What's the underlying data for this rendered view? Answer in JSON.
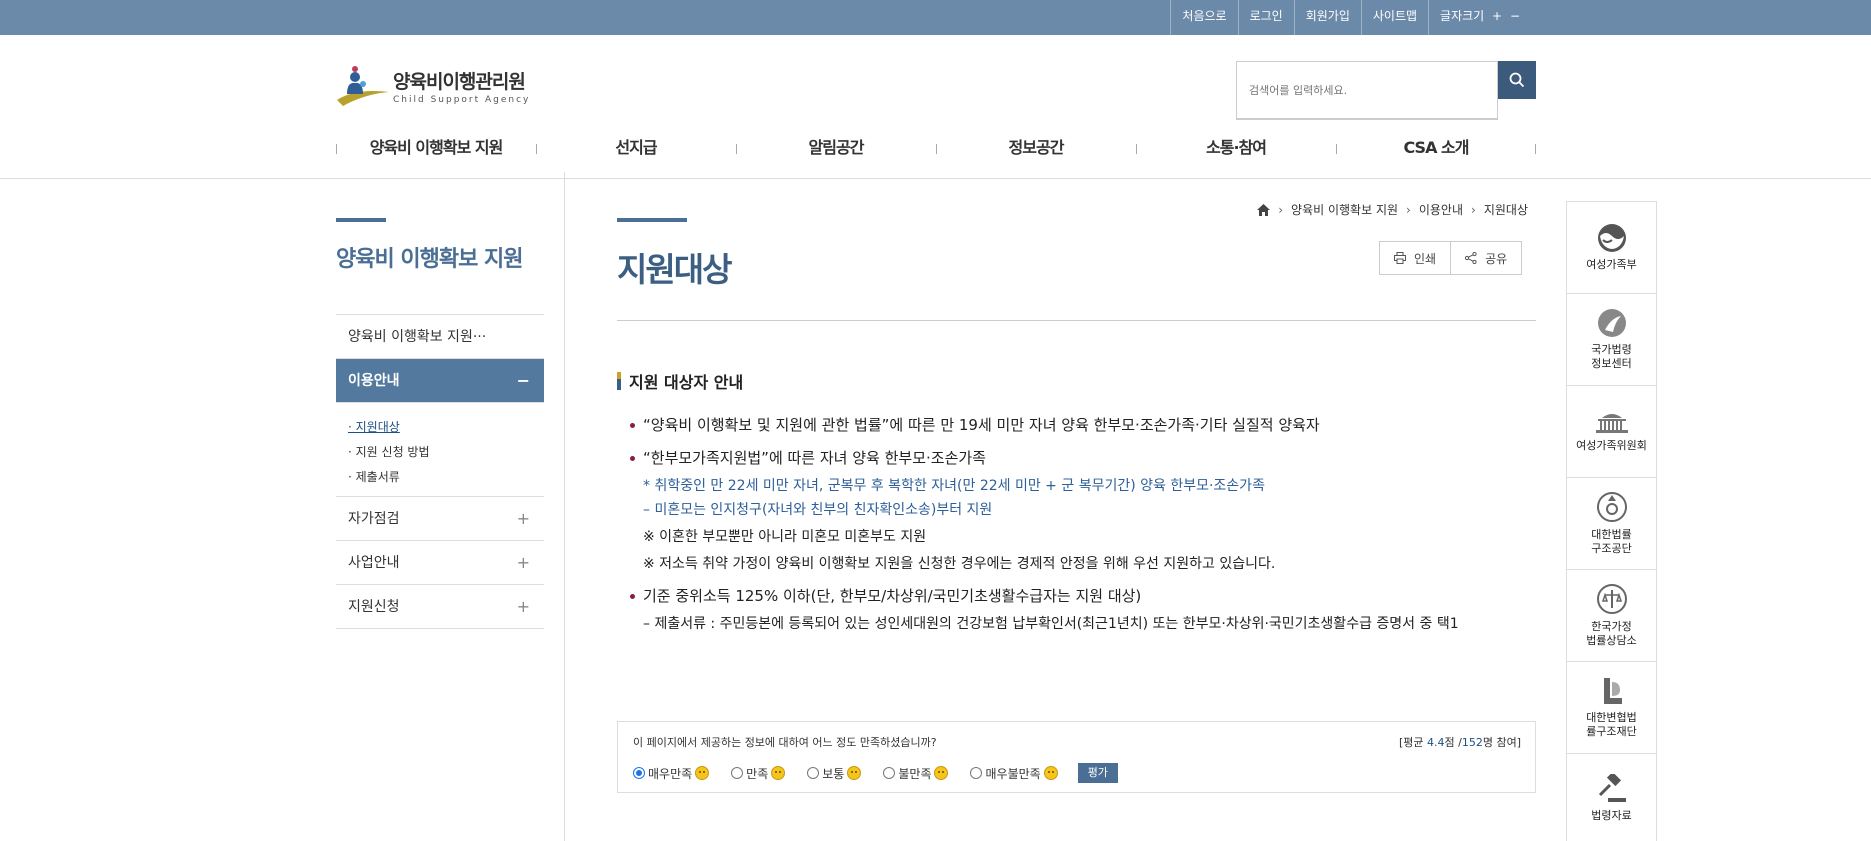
{
  "util_menu": [
    "처음으로",
    "로그인",
    "회원가입",
    "사이트맵"
  ],
  "font_size": {
    "label": "글자크기",
    "plus": "+",
    "minus": "−"
  },
  "logo": {
    "ko": "양육비이행관리원",
    "en": "Child Support Agency"
  },
  "search": {
    "placeholder": "검색어를 입력하세요.",
    "icon": "search-icon"
  },
  "gnb": [
    "양육비 이행확보 지원",
    "선지급",
    "알림공간",
    "정보공간",
    "소통·참여",
    "CSA 소개"
  ],
  "lnb": {
    "title": "양육비 이행확보 지원",
    "items": [
      {
        "label": "양육비 이행확보 지원···"
      },
      {
        "label": "이용안내",
        "toggle": "−"
      },
      {
        "label": "자가점검",
        "toggle": "+"
      },
      {
        "label": "사업안내",
        "toggle": "+"
      },
      {
        "label": "지원신청",
        "toggle": "+"
      }
    ],
    "sub": [
      "· 지원대상",
      "· 지원 신청 방법",
      "· 제출서류"
    ]
  },
  "breadcrumb": [
    "양육비 이행확보 지원",
    "이용안내",
    "지원대상"
  ],
  "page_title": "지원대상",
  "tools": {
    "print": "인쇄",
    "share": "공유"
  },
  "section_title": "지원 대상자 안내",
  "content": {
    "b1": "“양육비 이행확보 및 지원에 관한 법률”에 따른 만 19세 미만 자녀 양육 한부모·조손가족·기타 실질적 양육자",
    "b2": "“한부모가족지원법”에 따른 자녀 양육 한부모·조손가족",
    "n1": "* 취학중인 만 22세 미만 자녀, 군복무 후 복학한 자녀(만 22세 미만 + 군 복무기간) 양육 한부모·조손가족",
    "n2": "– 미혼모는 인지청구(자녀와 친부의 친자확인소송)부터 지원",
    "n3": "※ 이혼한 부모뿐만 아니라 미혼모 미혼부도 지원",
    "n4": "※ 저소득 취약 가정이 양육비 이행확보 지원을 신청한 경우에는 경제적 안정을 위해 우선 지원하고 있습니다.",
    "b3": "기준 중위소득 125% 이하(단, 한부모/차상위/국민기초생활수급자는 지원 대상)",
    "n5": "– 제출서류 : 주민등본에 등록되어 있는 성인세대원의 건강보험 납부확인서(최근1년치) 또는 한부모·차상위·국민기초생활수급 증명서 중 택1"
  },
  "survey": {
    "question": "이 페이지에서 제공하는 정보에 대하여 어느 정도 만족하셨습니까?",
    "avg_prefix": "[평균 ",
    "avg_score": "4.4",
    "avg_mid": "점 /",
    "avg_count": "152",
    "avg_suffix": "명 참여]",
    "options": [
      "매우만족",
      "만족",
      "보통",
      "불만족",
      "매우불만족"
    ],
    "selected": "매우만족",
    "submit": "평가"
  },
  "quick_links": [
    "여성가족부",
    "국가법령\n정보센터",
    "여성가족위원회",
    "대한법률\n구조공단",
    "한국가정\n법률상담소",
    "대한변협법\n률구조재단",
    "법령자료"
  ],
  "colors": {
    "topbar": "#6b89a8",
    "accent": "#4a6e94",
    "active_menu": "#537a9e",
    "bullet": "#8b1e3f",
    "blue_text": "#2d5f9a"
  }
}
